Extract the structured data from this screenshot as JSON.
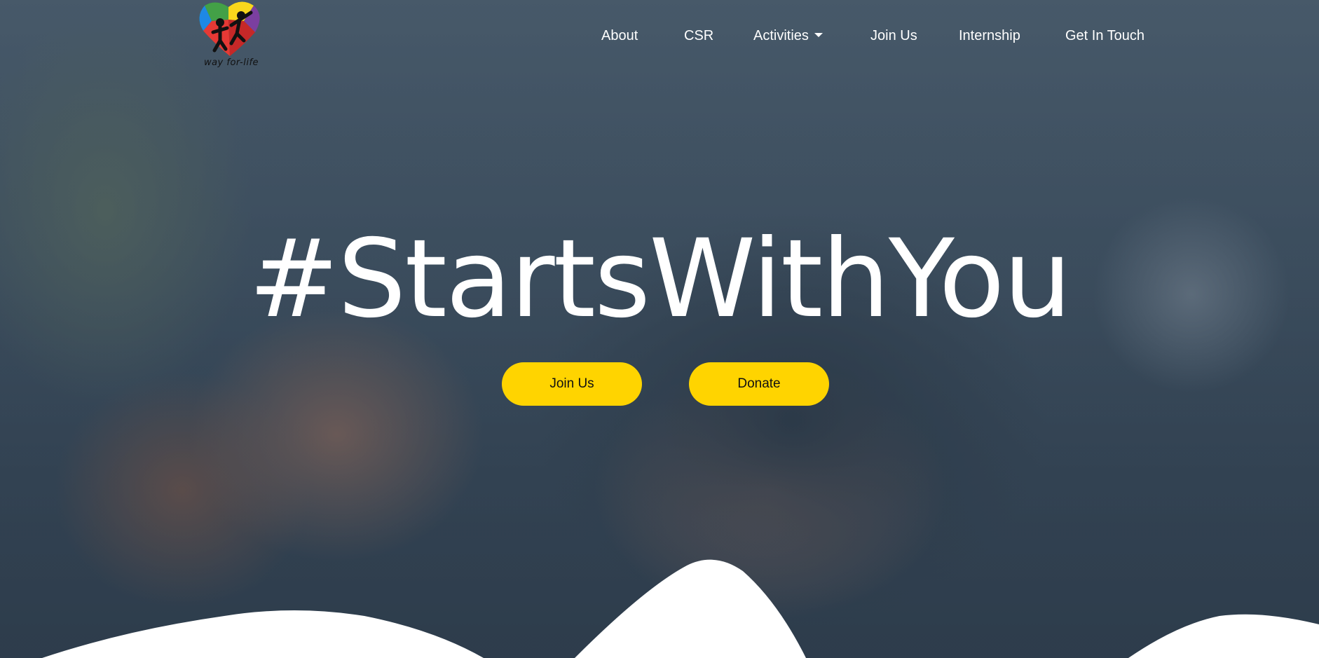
{
  "brand": {
    "logo_text": "way for-life"
  },
  "nav": {
    "items": [
      {
        "label": "About"
      },
      {
        "label": "CSR"
      },
      {
        "label": "Activities",
        "has_dropdown": true
      },
      {
        "label": "Join Us"
      },
      {
        "label": "Internship"
      },
      {
        "label": "Get In Touch"
      }
    ]
  },
  "hero": {
    "headline": "#StartsWithYou",
    "buttons": {
      "join_label": "Join Us",
      "donate_label": "Donate"
    }
  },
  "colors": {
    "accent": "#ffd400",
    "overlay": "#2c3e50",
    "text": "#ffffff"
  },
  "icons": {
    "dropdown": "chevron-down-icon",
    "logo": "puzzle-heart-logo"
  }
}
